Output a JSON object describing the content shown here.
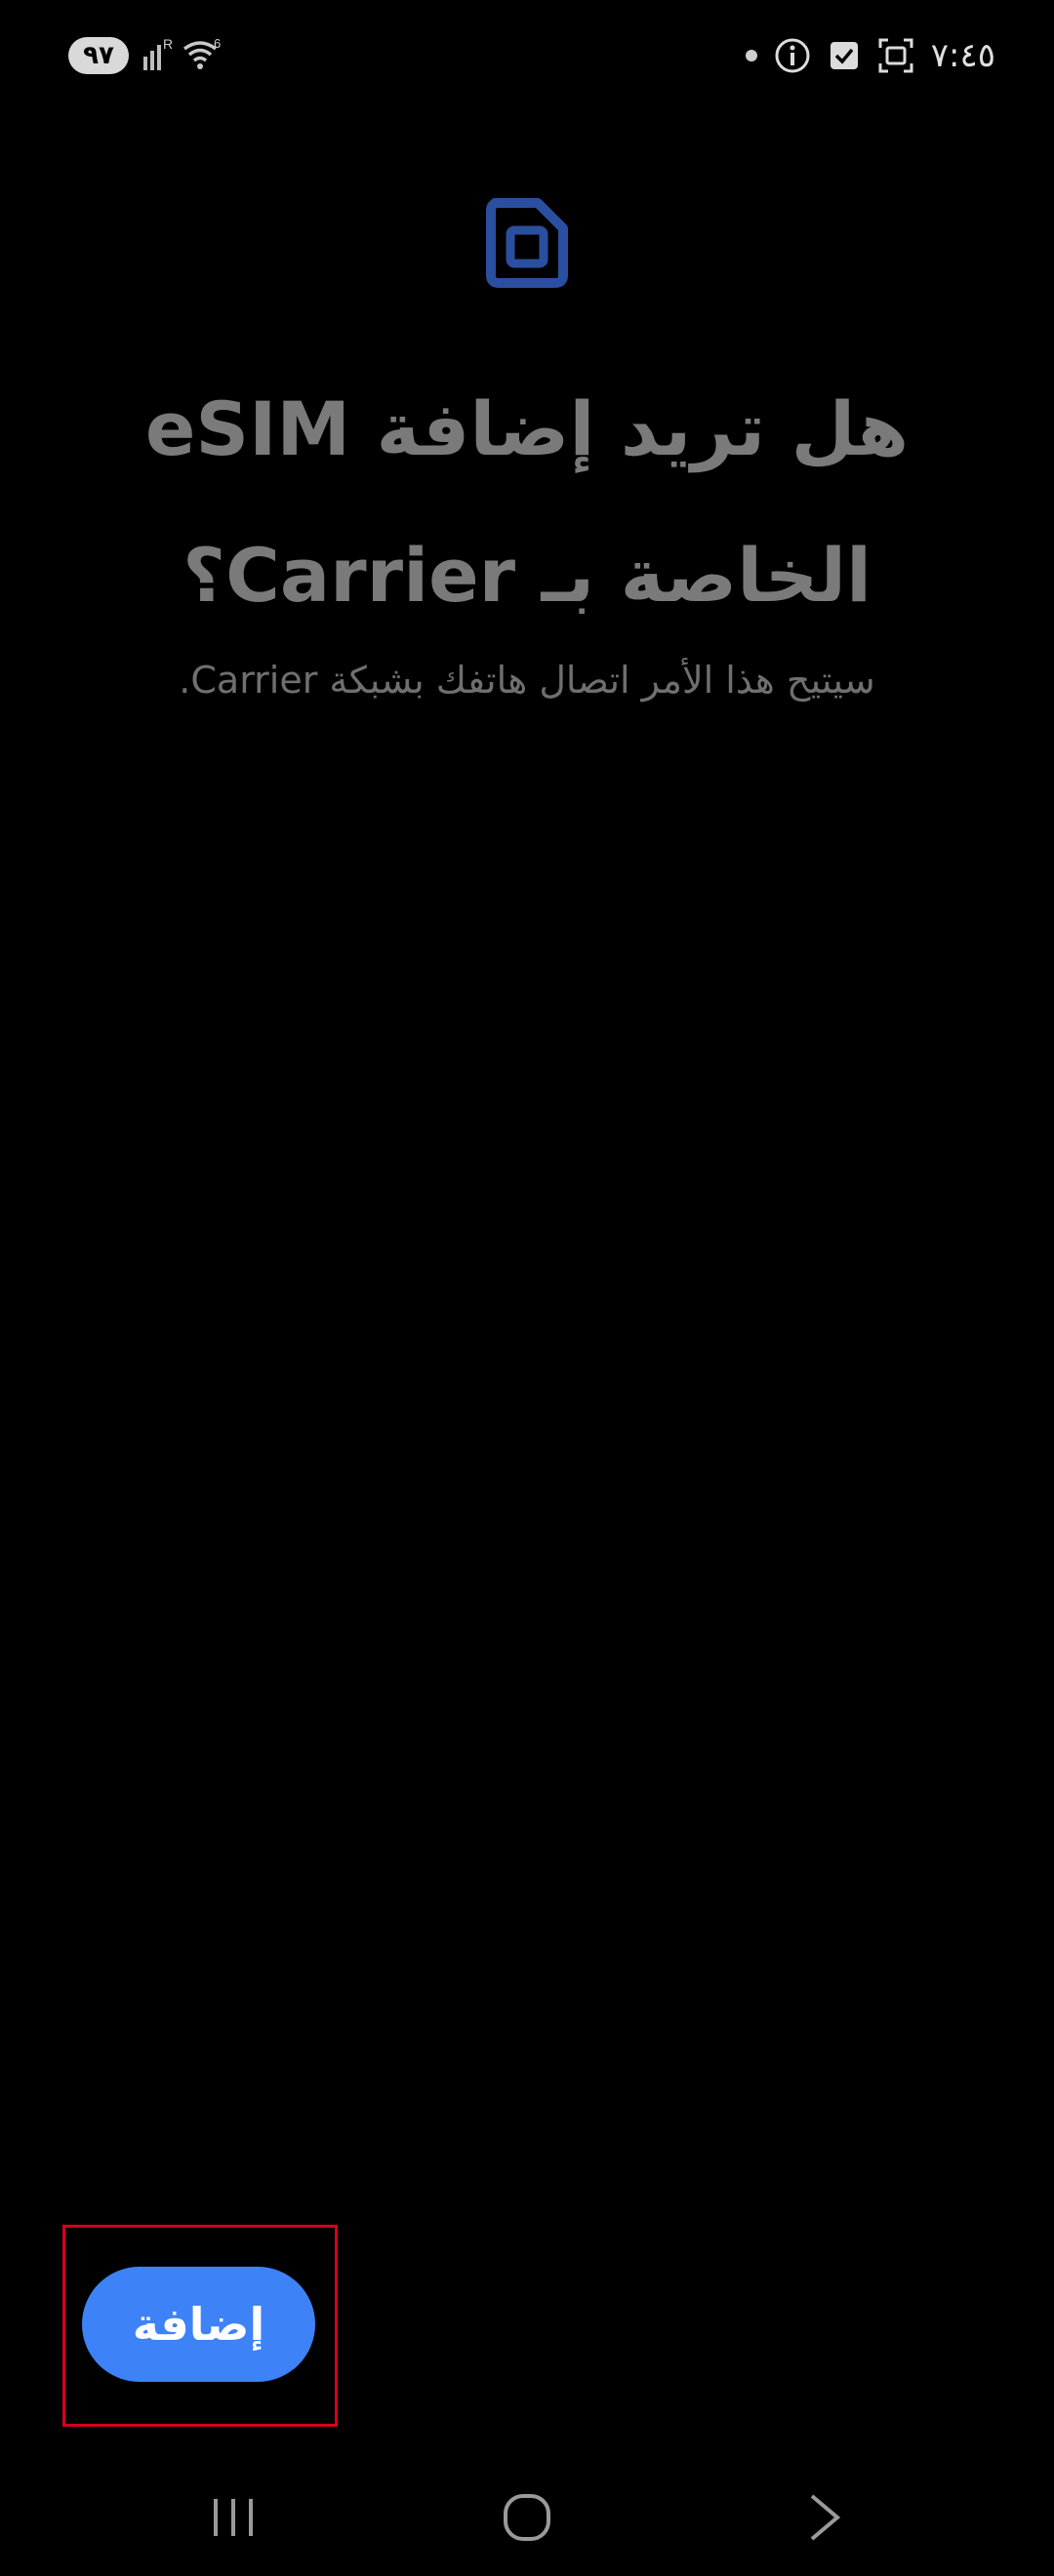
{
  "status_bar": {
    "battery": "٩٧",
    "network_label": "R",
    "wifi_label": "6",
    "time": "٧:٤٥",
    "icons": [
      "signal-icon",
      "wifi-icon",
      "dot-icon",
      "info-icon",
      "checkbox-icon",
      "screenshot-icon"
    ]
  },
  "main": {
    "icon": "sim-card-icon",
    "title_line1": "هل تريد إضافة eSIM",
    "title_line2": "الخاصة بـ Carrier؟",
    "subtitle": "سيتيح هذا الأمر اتصال هاتفك بشبكة Carrier."
  },
  "actions": {
    "add_label": "إضافة"
  },
  "nav_bar": {
    "icons": [
      "recent-apps-icon",
      "home-icon",
      "back-icon"
    ]
  },
  "colors": {
    "accent": "#3e82f7",
    "icon_blue": "#2b4fa0",
    "title_gray": "#7a7a7a",
    "highlight_red": "#d6001c"
  }
}
